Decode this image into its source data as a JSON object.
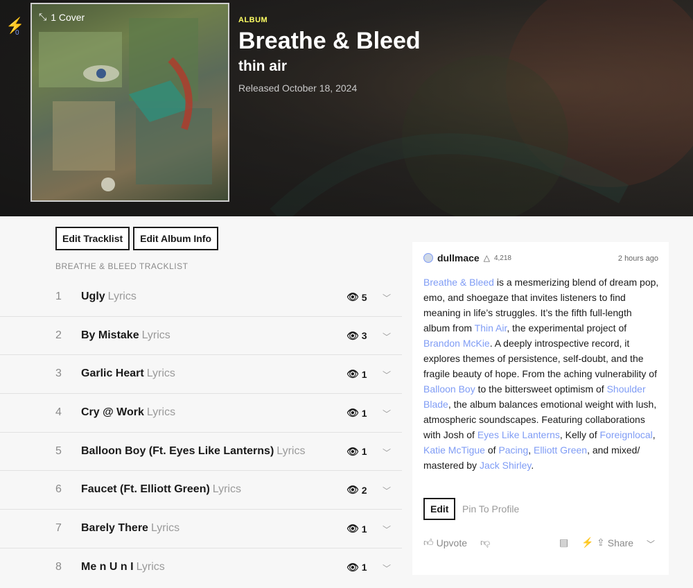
{
  "header": {
    "notif_count": "0",
    "cover_label": "1 Cover",
    "album_tag": "ALBUM",
    "title": "Breathe & Bleed",
    "artist": "thin air",
    "released": "Released October 18, 2024"
  },
  "buttons": {
    "edit_tracklist": "Edit Tracklist",
    "edit_album_info": "Edit Album Info"
  },
  "tracklist_heading": "BREATHE & BLEED TRACKLIST",
  "tracks": [
    {
      "num": "1",
      "title": "Ugly",
      "lyrics": "Lyrics",
      "views": "5"
    },
    {
      "num": "2",
      "title": "By Mistake",
      "lyrics": "Lyrics",
      "views": "3"
    },
    {
      "num": "3",
      "title": "Garlic Heart",
      "lyrics": "Lyrics",
      "views": "1"
    },
    {
      "num": "4",
      "title": "Cry @ Work",
      "lyrics": "Lyrics",
      "views": "1"
    },
    {
      "num": "5",
      "title": "Balloon Boy (Ft. Eyes Like Lanterns)",
      "lyrics": "Lyrics",
      "views": "1"
    },
    {
      "num": "6",
      "title": "Faucet (Ft. Elliott Green)",
      "lyrics": "Lyrics",
      "views": "2"
    },
    {
      "num": "7",
      "title": "Barely There",
      "lyrics": "Lyrics",
      "views": "1"
    },
    {
      "num": "8",
      "title": "Me n U n I",
      "lyrics": "Lyrics",
      "views": "1"
    }
  ],
  "annotation": {
    "author": "dullmace",
    "iq": "4,218",
    "time": "2 hours ago",
    "desc": [
      {
        "t": "Breathe & Bleed",
        "link": true
      },
      {
        "t": " is a mesmerizing blend of dream pop, emo, and shoegaze that invites listeners to find meaning in life’s struggles. It’s the fifth full-length album from ",
        "link": false
      },
      {
        "t": "Thin Air",
        "link": true
      },
      {
        "t": ", the experimental project of ",
        "link": false
      },
      {
        "t": "Brandon McKie",
        "link": true
      },
      {
        "t": ". A deeply introspective record, it explores themes of persistence, self-doubt, and the fragile beauty of hope. From the aching vulnerability of ",
        "link": false
      },
      {
        "t": "Balloon Boy",
        "link": true
      },
      {
        "t": " to the bittersweet optimism of ",
        "link": false
      },
      {
        "t": "Shoulder Blade",
        "link": true
      },
      {
        "t": ", the album balances emotional weight with lush, atmospheric soundscapes. Featuring collaborations with Josh of ",
        "link": false
      },
      {
        "t": "Eyes Like Lanterns",
        "link": true
      },
      {
        "t": ", Kelly of ",
        "link": false
      },
      {
        "t": "Foreignlocal",
        "link": true
      },
      {
        "t": ", ",
        "link": false
      },
      {
        "t": "Katie McTigue",
        "link": true
      },
      {
        "t": " of ",
        "link": false
      },
      {
        "t": "Pacing",
        "link": true
      },
      {
        "t": ", ",
        "link": false
      },
      {
        "t": "Elliott Green",
        "link": true
      },
      {
        "t": ", and mixed/ mastered by ",
        "link": false
      },
      {
        "t": "Jack Shirley",
        "link": true
      },
      {
        "t": ".",
        "link": false
      }
    ],
    "edit_label": "Edit",
    "pin_label": "Pin To Profile",
    "upvote_label": "Upvote",
    "share_label": "Share"
  }
}
